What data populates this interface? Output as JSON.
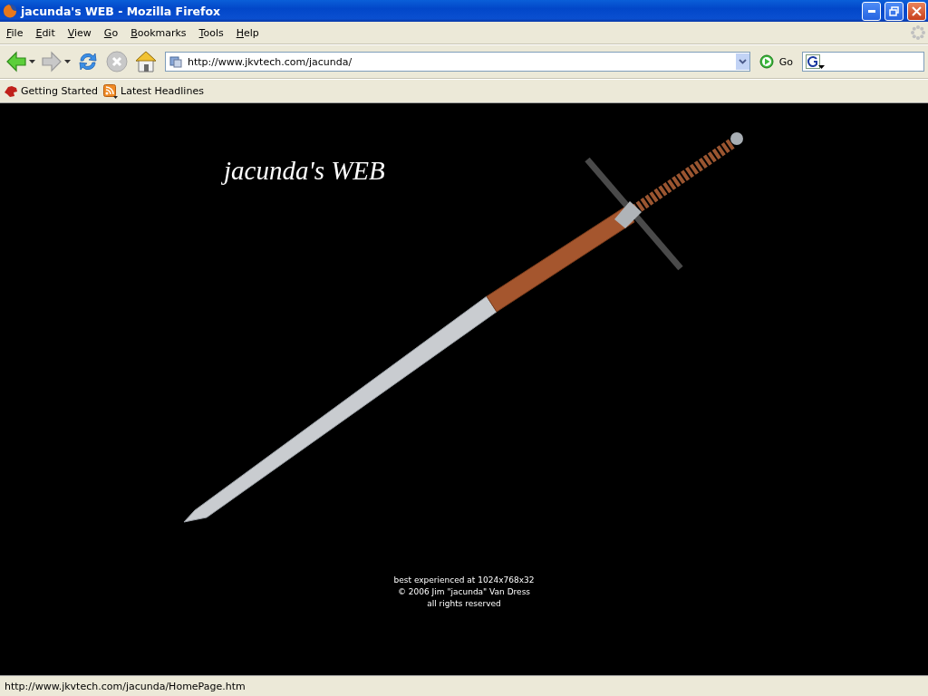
{
  "window": {
    "title": "jacunda's WEB - Mozilla Firefox"
  },
  "menu": [
    "File",
    "Edit",
    "View",
    "Go",
    "Bookmarks",
    "Tools",
    "Help"
  ],
  "nav_buttons": [
    {
      "kind": "back",
      "disabled": false
    },
    {
      "kind": "forward",
      "disabled": true
    },
    {
      "kind": "reload",
      "disabled": false
    },
    {
      "kind": "stop",
      "disabled": true
    },
    {
      "kind": "home",
      "disabled": false
    }
  ],
  "address": {
    "value": "http://www.jkvtech.com/jacunda/",
    "go_label": "Go"
  },
  "bookmarks": [
    {
      "kind": "getting-started",
      "label": "Getting Started"
    },
    {
      "kind": "feed",
      "label": "Latest Headlines"
    }
  ],
  "page": {
    "heading": "jacunda's WEB",
    "footer": [
      "best experienced at 1024x768x32",
      "© 2006 Jim \"jacunda\" Van Dress",
      "all rights reserved"
    ]
  },
  "status_bar": "http://www.jkvtech.com/jacunda/HomePage.htm"
}
